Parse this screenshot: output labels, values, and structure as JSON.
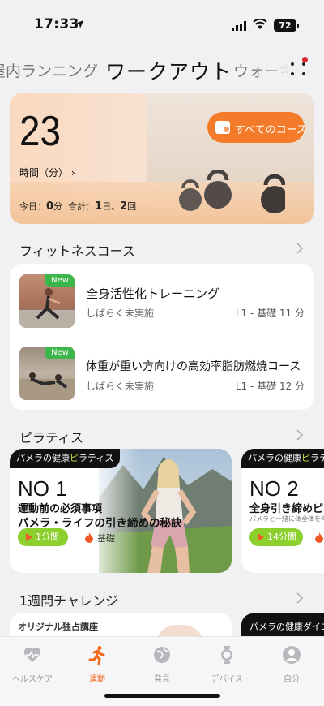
{
  "status_bar": {
    "time": "17:33",
    "battery": "72"
  },
  "tabs": {
    "left": "屋内ランニング",
    "active": "ワークアウト",
    "right": "ウォーキ"
  },
  "hero": {
    "value": "23",
    "label": "時間（分）",
    "today_label": "今日：",
    "today_value": "0",
    "today_unit": "分",
    "total_label": "合計：",
    "total_days": "1",
    "total_days_unit": "日、",
    "total_count": "2",
    "total_count_unit": "回",
    "all_courses_button": "すべてのコース"
  },
  "fitness": {
    "title": "フィットネスコース",
    "courses": [
      {
        "badge": "New",
        "title": "全身活性化トレーニング",
        "status": "しばらく未実施",
        "level": "L1 - 基礎 11 分"
      },
      {
        "badge": "New",
        "title": "体重が重い方向けの高効率脂肪燃焼コース",
        "status": "しばらく未実施",
        "level": "L1 - 基礎 12 分"
      }
    ]
  },
  "pilates": {
    "title": "ピラティス",
    "cards": [
      {
        "brand_a": "パメラの健康",
        "brand_b": "ピ",
        "brand_c": "ラティス",
        "no": "NO 1",
        "line1": "運動前の必須事項",
        "line2": "パメラ・ライフの引き締めの秘訣",
        "duration": "1分間",
        "level": "基礎"
      },
      {
        "brand_a": "パメラの健康",
        "brand_b": "ピ",
        "brand_c": "ラティ",
        "no": "NO 2",
        "line1": "全身引き締めピラ",
        "line2": "パメラと一緒に体全体を伸ばし",
        "duration": "14分間",
        "level": ""
      }
    ]
  },
  "challenge": {
    "title": "1週間チャレンジ",
    "card1_label": "オリジナル独占講座",
    "card2_label": "パメラの健康ダイエ"
  },
  "nav": [
    {
      "label": "ヘルスケア",
      "icon": "health-icon",
      "active": false
    },
    {
      "label": "運動",
      "icon": "run-icon",
      "active": true
    },
    {
      "label": "発見",
      "icon": "discover-icon",
      "active": false
    },
    {
      "label": "デバイス",
      "icon": "watch-icon",
      "active": false
    },
    {
      "label": "自分",
      "icon": "profile-icon",
      "active": false
    }
  ],
  "colors": {
    "accent": "#f36a1c",
    "new_badge": "#3cb54a",
    "duration_pill": "#8bd02d"
  }
}
